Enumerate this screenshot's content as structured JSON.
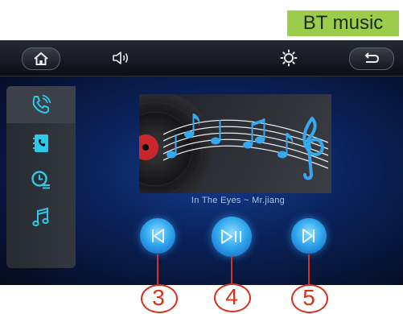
{
  "badge": {
    "label": "BT music"
  },
  "topbar": {
    "home": "home-icon",
    "volume": "speaker-icon",
    "brightness": "brightness-icon",
    "back": "back-icon"
  },
  "sidebar": {
    "items": [
      {
        "icon": "phone-call-icon",
        "active": true
      },
      {
        "icon": "contacts-book-icon",
        "active": false
      },
      {
        "icon": "call-history-icon",
        "active": false
      },
      {
        "icon": "music-note-icon",
        "active": false
      }
    ]
  },
  "player": {
    "track": "In The Eyes ~ Mr.jiang",
    "controls": [
      "previous-track-icon",
      "play-pause-icon",
      "next-track-icon"
    ]
  },
  "callouts": [
    "3",
    "4",
    "5"
  ],
  "colors": {
    "badge_bg": "#9ccc4c",
    "accent_blue": "#33a9ef",
    "icon_cyan": "#2ec8e8",
    "callout_red": "#d6321f"
  }
}
